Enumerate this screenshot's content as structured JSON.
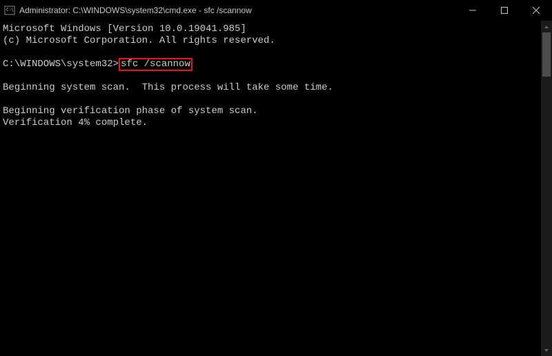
{
  "titlebar": {
    "title": "Administrator: C:\\WINDOWS\\system32\\cmd.exe - sfc  /scannow"
  },
  "terminal": {
    "version_line": "Microsoft Windows [Version 10.0.19041.985]",
    "copyright_line": "(c) Microsoft Corporation. All rights reserved.",
    "prompt_prefix": "C:\\WINDOWS\\system32>",
    "command": "sfc /scannow",
    "scan_begin": "Beginning system scan.  This process will take some time.",
    "verify_begin": "Beginning verification phase of system scan.",
    "verify_progress": "Verification 4% complete."
  }
}
